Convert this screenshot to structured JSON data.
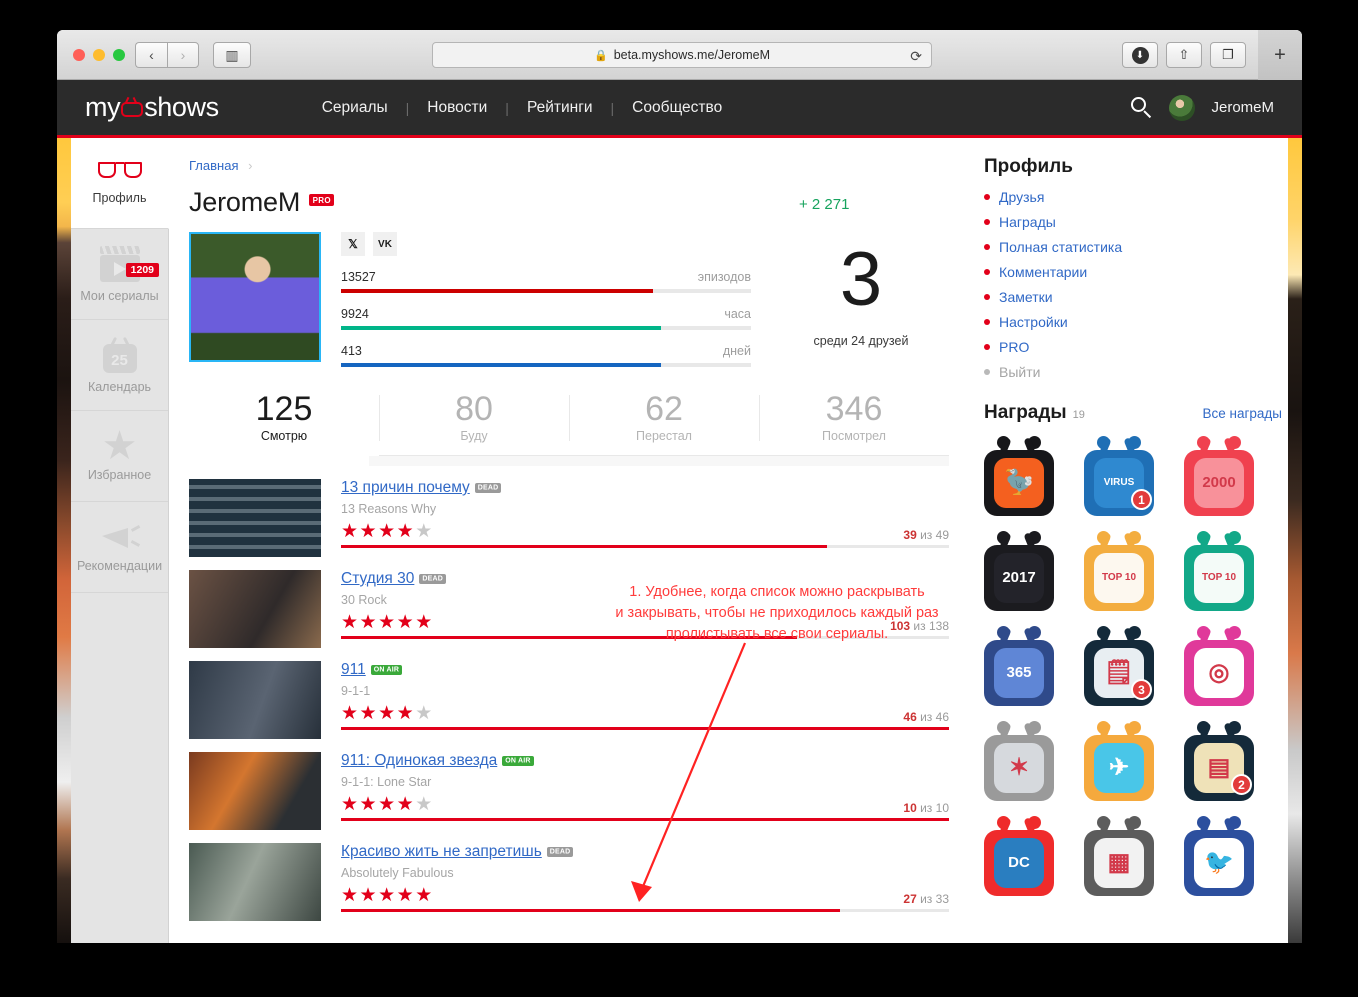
{
  "browser": {
    "url": "beta.myshows.me/JeromeM",
    "lock_icon": "lock-icon",
    "back_icon": "‹",
    "forward_icon": "›",
    "sidebar_icon": "▥",
    "reload_icon": "⟳",
    "download_icon": "⬇",
    "share_icon": "⇧",
    "tabs_icon": "❐",
    "new_tab_icon": "+"
  },
  "header": {
    "logo_pre": "my",
    "logo_post": "shows",
    "nav": [
      {
        "label": "Сериалы"
      },
      {
        "label": "Новости"
      },
      {
        "label": "Рейтинги"
      },
      {
        "label": "Сообщество"
      }
    ],
    "separator": "|",
    "search_icon": "search-icon",
    "user_name": "JeromeM"
  },
  "left_rail": [
    {
      "label": "Профиль",
      "icon": "glasses-icon",
      "active": true,
      "badge": null
    },
    {
      "label": "Мои сериалы",
      "icon": "clapper-icon",
      "active": false,
      "badge": "1209"
    },
    {
      "label": "Календарь",
      "icon": "tv-calendar-icon",
      "active": false,
      "badge": null
    },
    {
      "label": "Избранное",
      "icon": "star-icon",
      "active": false,
      "badge": null
    },
    {
      "label": "Рекомендации",
      "icon": "megaphone-icon",
      "active": false,
      "badge": null
    }
  ],
  "breadcrumb": {
    "home": "Главная",
    "chevron": "›"
  },
  "profile": {
    "name": "JeromeM",
    "pro_badge": "PRO",
    "points": "+ 2 271",
    "social": [
      {
        "name": "twitter-icon",
        "glyph": "🐦"
      },
      {
        "name": "vk-icon",
        "glyph": "VK"
      }
    ],
    "bars": [
      {
        "value": "13527",
        "unit": "эпизодов",
        "percent": 76,
        "color": "#cc0000"
      },
      {
        "value": "9924",
        "unit": "часа",
        "percent": 78,
        "color": "#00b589"
      },
      {
        "value": "413",
        "unit": "дней",
        "percent": 78,
        "color": "#1565c0"
      }
    ],
    "rank_number": "3",
    "rank_sub": "среди 24 друзей"
  },
  "tabs": [
    {
      "num": "125",
      "label": "Смотрю",
      "active": true
    },
    {
      "num": "80",
      "label": "Буду",
      "active": false
    },
    {
      "num": "62",
      "label": "Перестал",
      "active": false
    },
    {
      "num": "346",
      "label": "Посмотрел",
      "active": false
    }
  ],
  "shows": [
    {
      "title": "13 причин почему",
      "badge": "DEAD",
      "badge_type": "dead",
      "original": "13 Reasons Why",
      "stars": 4,
      "watched": "39",
      "of_word": "из",
      "total": "49",
      "percent": 80,
      "thumb_class": "th1"
    },
    {
      "title": "Студия 30",
      "badge": "DEAD",
      "badge_type": "dead",
      "original": "30 Rock",
      "stars": 5,
      "watched": "103",
      "of_word": "из",
      "total": "138",
      "percent": 75,
      "thumb_class": "th2"
    },
    {
      "title": "911",
      "badge": "ON AIR",
      "badge_type": "onair",
      "original": "9-1-1",
      "stars": 4,
      "watched": "46",
      "of_word": "из",
      "total": "46",
      "percent": 100,
      "thumb_class": "th3"
    },
    {
      "title": "911: Одинокая звезда",
      "badge": "ON AIR",
      "badge_type": "onair",
      "original": "9-1-1: Lone Star",
      "stars": 4,
      "watched": "10",
      "of_word": "из",
      "total": "10",
      "percent": 100,
      "thumb_class": "th4"
    },
    {
      "title": "Красиво жить не запретишь",
      "badge": "DEAD",
      "badge_type": "dead",
      "original": "Absolutely Fabulous",
      "stars": 5,
      "watched": "27",
      "of_word": "из",
      "total": "33",
      "percent": 82,
      "thumb_class": "th5"
    }
  ],
  "sidebar": {
    "profile_heading": "Профиль",
    "links": [
      {
        "label": "Друзья",
        "muted": false
      },
      {
        "label": "Награды",
        "muted": false
      },
      {
        "label": "Полная статистика",
        "muted": false
      },
      {
        "label": "Комментарии",
        "muted": false
      },
      {
        "label": "Заметки",
        "muted": false
      },
      {
        "label": "Настройки",
        "muted": false
      },
      {
        "label": "PRO",
        "muted": false
      },
      {
        "label": "Выйти",
        "muted": true
      }
    ],
    "awards_heading": "Награды",
    "awards_count": "19",
    "all_awards_label": "Все награды",
    "awards": [
      {
        "name": "dodo-bird-award",
        "frame": "#17171a",
        "inner": "#f4601f",
        "text": "",
        "badge": null,
        "glyph": "🦤"
      },
      {
        "name": "virus-2020-award",
        "frame": "#1f6fb5",
        "inner": "#2f89d0",
        "text": "VIRUS",
        "badge": "1",
        "glyph": ""
      },
      {
        "name": "2000-episodes-award",
        "frame": "#f0414f",
        "inner": "#f8919a",
        "text": "2000",
        "badge": null,
        "glyph": ""
      },
      {
        "name": "myshows-2017-awards",
        "frame": "#1b1b1f",
        "inner": "#23232a",
        "text": "2017",
        "badge": null,
        "glyph": ""
      },
      {
        "name": "top-10-2017-award",
        "frame": "#f3ad3f",
        "inner": "#fdf8ef",
        "text": "TOP 10",
        "badge": null,
        "glyph": ""
      },
      {
        "name": "top-10-2016-award",
        "frame": "#12a888",
        "inner": "#f4fbf8",
        "text": "TOP 10",
        "badge": null,
        "glyph": ""
      },
      {
        "name": "365-days-award",
        "frame": "#2f4a8a",
        "inner": "#5f86d6",
        "text": "365",
        "badge": null,
        "glyph": ""
      },
      {
        "name": "notes-award",
        "frame": "#142a3a",
        "inner": "#e8eef2",
        "text": "",
        "badge": "3",
        "glyph": "🗒"
      },
      {
        "name": "instagram-award",
        "frame": "#e0399a",
        "inner": "#ffffff",
        "text": "",
        "badge": null,
        "glyph": "◎"
      },
      {
        "name": "captain-america-award",
        "frame": "#9a9a9a",
        "inner": "#d6d9dd",
        "text": "",
        "badge": null,
        "glyph": "✶"
      },
      {
        "name": "airplane-award",
        "frame": "#f5a93d",
        "inner": "#49c6e8",
        "text": "",
        "badge": null,
        "glyph": "✈"
      },
      {
        "name": "archive-award",
        "frame": "#142a3a",
        "inner": "#efe2b8",
        "text": "",
        "badge": "2",
        "glyph": "▤"
      },
      {
        "name": "dc-comics-award",
        "frame": "#ef2b2b",
        "inner": "#2a7ec0",
        "text": "DC",
        "badge": null,
        "glyph": ""
      },
      {
        "name": "chess-award",
        "frame": "#5c5c5c",
        "inner": "#f2f2f2",
        "text": "",
        "badge": null,
        "glyph": "▦"
      },
      {
        "name": "twitter-bird-award",
        "frame": "#2c4f9e",
        "inner": "#ffffff",
        "text": "",
        "badge": null,
        "glyph": "🐦"
      }
    ]
  },
  "annotation": {
    "line1": "1. Удобнее, когда список можно раскрывать",
    "line2": "и закрывать, чтобы не приходилось каждый раз",
    "line3": "пролистывать все свои сериалы.",
    "color": "#ff3b3b"
  }
}
